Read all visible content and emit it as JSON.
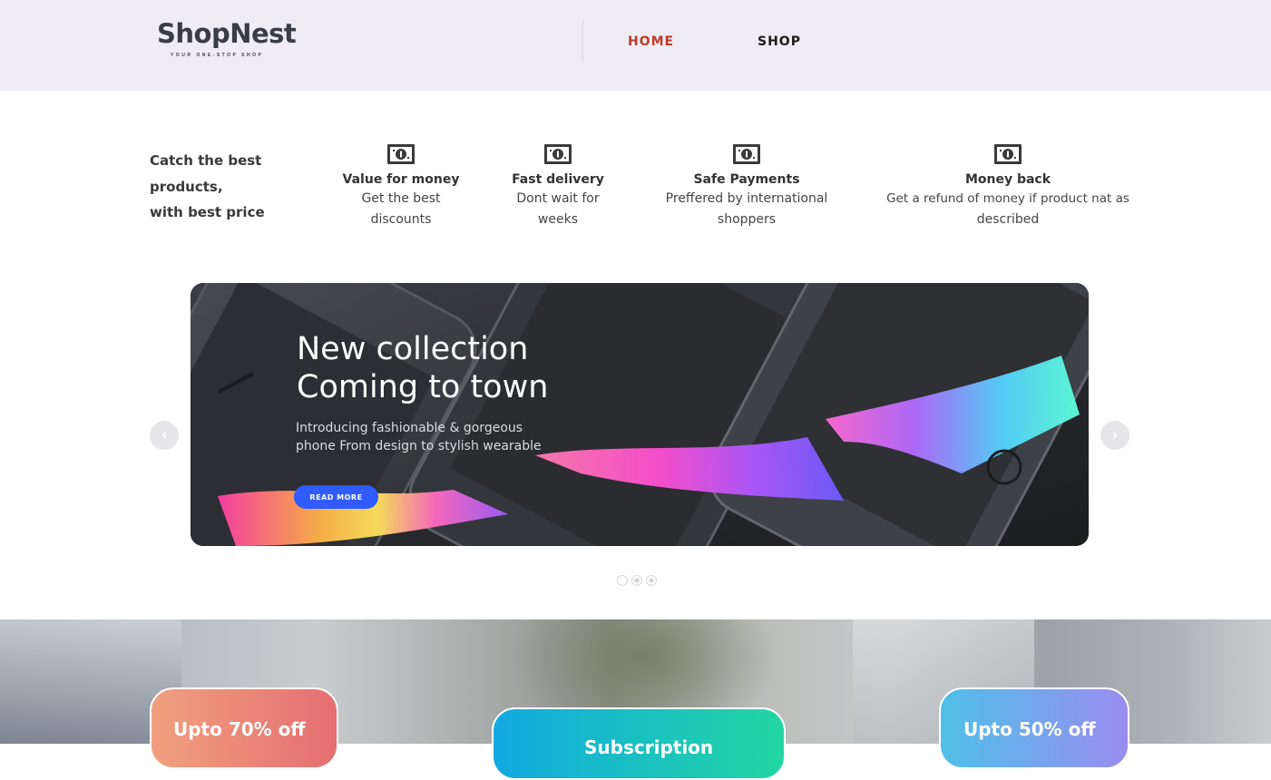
{
  "header": {
    "logo": "ShopNest",
    "tagline": "YOUR ONE-STOP SHOP",
    "nav": [
      {
        "label": "HOME",
        "active": true
      },
      {
        "label": "SHOP",
        "active": false
      }
    ]
  },
  "intro": {
    "tagline_lines": [
      "Catch the best",
      "products,",
      "with best price"
    ]
  },
  "features": [
    {
      "icon": "money-bill-icon",
      "title": "Value for money",
      "desc_lines": [
        "Get the best",
        "discounts"
      ]
    },
    {
      "icon": "money-bill-icon",
      "title": "Fast delivery",
      "desc_lines": [
        "Dont wait for",
        "weeks"
      ]
    },
    {
      "icon": "money-bill-icon",
      "title": "Safe Payments",
      "desc_lines": [
        "Preffered by international",
        "shoppers"
      ]
    },
    {
      "icon": "money-bill-icon",
      "title": "Money back",
      "desc_lines": [
        "Get a refund of money if product nat as",
        "described"
      ]
    }
  ],
  "slider": {
    "heading_lines": [
      "New collection",
      "Coming to town"
    ],
    "desc_lines": [
      "Introducing fashionable & gorgeous",
      "phone From design to stylish wearable"
    ],
    "button_label": "READ MORE",
    "prev_icon": "chevron-left-icon",
    "next_icon": "chevron-right-icon",
    "prev_glyph": "‹",
    "next_glyph": "›",
    "dot_count": 3,
    "active_dot": 0
  },
  "promos": [
    {
      "label": "Upto 70% off"
    },
    {
      "label": "Subscription"
    },
    {
      "label": "Upto 50% off"
    }
  ],
  "colors": {
    "header_bg": "#efedf3",
    "nav_active": "#c0392b",
    "button_blue": "#2f5bff"
  }
}
